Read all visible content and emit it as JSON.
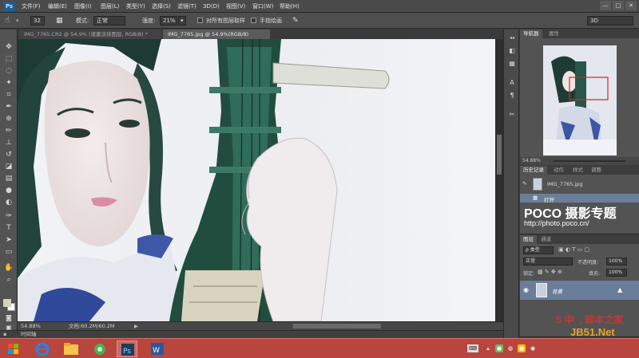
{
  "app": {
    "logo": "Ps"
  },
  "menu": [
    "文件(F)",
    "编辑(E)",
    "图像(I)",
    "图层(L)",
    "类型(Y)",
    "选择(S)",
    "滤镜(T)",
    "3D(D)",
    "视图(V)",
    "窗口(W)",
    "帮助(H)"
  ],
  "window_buttons": [
    "—",
    "□",
    "✕"
  ],
  "options": {
    "brush_size": "32",
    "mode_label": "模式:",
    "mode_value": "正常",
    "strength_label": "强度:",
    "strength_value": "21%",
    "sample_all": "对所有图层取样",
    "finger_paint": "手指绘画",
    "workspace": "3D"
  },
  "tabs": [
    {
      "label": "IMG_7765.CR2 @ 54.9% (液畫涂抹图层, RGB/8) *",
      "active": false
    },
    {
      "label": "IMG_7765.jpg @ 54.9%(RGB/8)",
      "active": true
    }
  ],
  "status": {
    "zoom": "54.88%",
    "doc": "文档:60.2M/60.2M"
  },
  "timeline": "时间轴",
  "navigator": {
    "tabs": [
      "导航器",
      "属性"
    ],
    "zoom": "54.88%"
  },
  "history": {
    "tabs": [
      "历史记录",
      "动作",
      "样式",
      "调整"
    ],
    "snapshot": "IMG_7765.jpg",
    "steps": [
      "打开"
    ]
  },
  "layers": {
    "tabs": [
      "图层",
      "通道"
    ],
    "kind": "ρ 类型",
    "blend": "正常",
    "opacity_label": "不透明度:",
    "opacity_value": "100%",
    "lock_label": "锁定:",
    "fill_label": "填充:",
    "fill_value": "100%",
    "items": [
      {
        "name": "背景",
        "visible": true,
        "locked": true
      }
    ]
  },
  "watermark": {
    "brand": "POCO 摄影专题",
    "url": "http://photo.poco.cn/"
  },
  "site_watermark": {
    "top": "S 中 ·, 脚本之家",
    "bottom": "JB51.Net"
  },
  "icons": {
    "tools": [
      "move-icon",
      "marquee-icon",
      "lasso-icon",
      "magic-wand-icon",
      "crop-icon",
      "eyedropper-icon",
      "healing-icon",
      "brush-icon",
      "stamp-icon",
      "history-brush-icon",
      "eraser-icon",
      "gradient-icon",
      "blur-icon",
      "dodge-icon",
      "pen-icon",
      "type-icon",
      "path-select-icon",
      "shape-icon",
      "hand-icon",
      "zoom-icon"
    ]
  },
  "colors": {
    "taskbar": "#b9453f",
    "selection": "#6b7e99",
    "ps_blue": "#1f5d8c"
  }
}
